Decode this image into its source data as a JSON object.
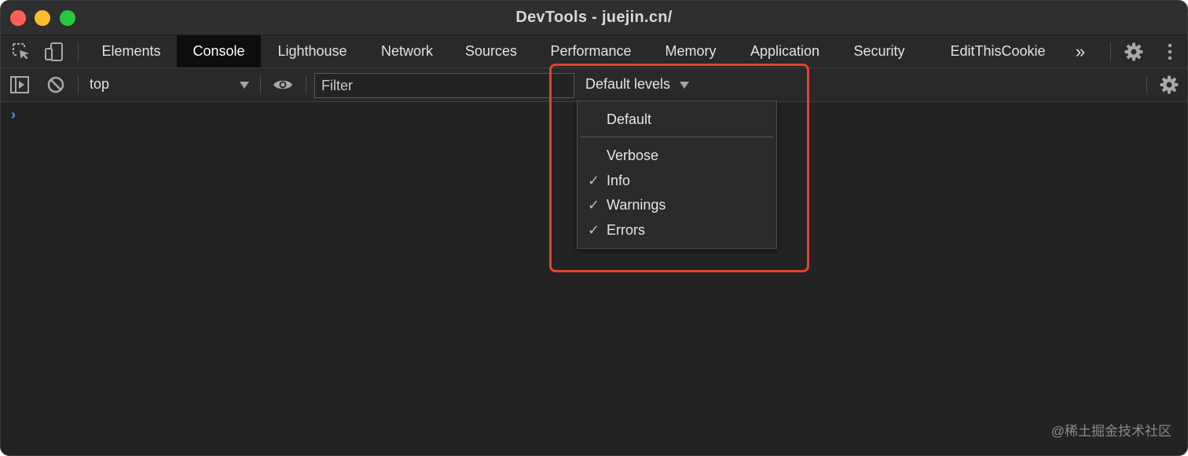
{
  "window": {
    "title": "DevTools - juejin.cn/"
  },
  "toolbar": {
    "tabs": [
      {
        "label": "Elements"
      },
      {
        "label": "Console",
        "active": true
      },
      {
        "label": "Lighthouse"
      },
      {
        "label": "Network"
      },
      {
        "label": "Sources"
      },
      {
        "label": "Performance"
      },
      {
        "label": "Memory"
      },
      {
        "label": "Application"
      },
      {
        "label": "Security"
      },
      {
        "label": "EditThisCookie"
      }
    ],
    "more_label": "»"
  },
  "console_toolbar": {
    "context": "top",
    "filter_placeholder": "Filter",
    "levels_label": "Default levels"
  },
  "levels_menu": {
    "items": [
      {
        "label": "Default",
        "checked": false
      },
      {
        "label": "Verbose",
        "checked": false
      },
      {
        "label": "Info",
        "checked": true
      },
      {
        "label": "Warnings",
        "checked": true
      },
      {
        "label": "Errors",
        "checked": true
      }
    ],
    "check_glyph": "✓"
  },
  "console": {
    "prompt": "›"
  },
  "watermark": "@稀土掘金技术社区",
  "colors": {
    "background": "#232323",
    "toolbar": "#292929",
    "active_tab": "#0d0d0d",
    "prompt": "#4f8ff7",
    "highlight": "#e1442f"
  },
  "icons": [
    "inspect-element-icon",
    "device-toolbar-icon",
    "settings-gear-icon",
    "kebab-menu-icon",
    "sidebar-toggle-icon",
    "clear-console-icon",
    "eye-icon",
    "console-settings-gear-icon"
  ]
}
